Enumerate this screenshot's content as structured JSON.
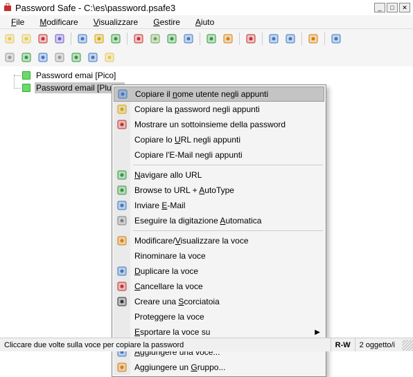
{
  "window": {
    "title": "Password Safe - C:\\es\\password.psafe3"
  },
  "menubar": {
    "file": "File",
    "edit": "Modificare",
    "view": "Visualizzare",
    "manage": "Gestire",
    "help": "Aiuto"
  },
  "tree": {
    "items": [
      {
        "label": "Password emai [Pico]",
        "selected": false
      },
      {
        "label": "Password email [Pluto]",
        "selected": true
      }
    ]
  },
  "context_menu": {
    "items": [
      {
        "label_html": "Copiare il <u>n</u>ome utente negli appunti",
        "icon": "user-icon",
        "accent": "#3a77c8",
        "hl": true
      },
      {
        "label_html": "Copiare la <u>p</u>assword negli appunti",
        "icon": "key-icon",
        "accent": "#d9a000"
      },
      {
        "label_html": "Mostrare un sottoinsieme della password",
        "icon": "subset-icon",
        "accent": "#c62e2e"
      },
      {
        "label_html": "Copiare lo <u>U</u>RL negli appunti"
      },
      {
        "label_html": "Copiare l'E-Mail negli appunti"
      },
      {
        "sep": true
      },
      {
        "label_html": "<u>N</u>avigare allo URL",
        "icon": "globe-icon",
        "accent": "#2e9a3a"
      },
      {
        "label_html": "Browse to URL + <u>A</u>utoType",
        "icon": "globe-plus-icon",
        "accent": "#2e9a3a"
      },
      {
        "label_html": "Inviare <u>E</u>-Mail",
        "icon": "mail-icon",
        "accent": "#3a77c8"
      },
      {
        "label_html": "Eseguire la digitazione <u>A</u>utomatica",
        "icon": "autotype-icon",
        "accent": "#808080"
      },
      {
        "sep": true
      },
      {
        "label_html": "Modificare/<u>V</u>isualizzare la voce",
        "icon": "pencil-icon",
        "accent": "#d97d00"
      },
      {
        "label_html": "Rinominare la voce"
      },
      {
        "label_html": "<u>D</u>uplicare la voce",
        "icon": "duplicate-icon",
        "accent": "#3a77c8"
      },
      {
        "label_html": "<u>C</u>ancellare la voce",
        "icon": "delete-icon",
        "accent": "#c62e2e"
      },
      {
        "label_html": "Creare una <u>S</u>corciatoia",
        "icon": "shortcut-icon",
        "accent": "#333333"
      },
      {
        "label_html": "Proteggere la voce"
      },
      {
        "label_html": "<u>E</u>sportare la voce su",
        "submenu": true
      },
      {
        "sep": true
      },
      {
        "label_html": "<u>A</u>ggiungere una voce...",
        "icon": "add-entry-icon",
        "accent": "#3a77c8"
      },
      {
        "label_html": "Aggiungere un <u>G</u>ruppo...",
        "icon": "add-group-icon",
        "accent": "#d97d00"
      }
    ]
  },
  "statusbar": {
    "left": "Cliccare due volte sulla voce per copiare la password",
    "rw": "R-W",
    "count": "2 oggetto/i"
  },
  "toolbar1": [
    {
      "name": "new-file-icon",
      "accent": "#e6c84a"
    },
    {
      "name": "open-file-icon",
      "accent": "#e6c84a"
    },
    {
      "name": "close-icon",
      "accent": "#c62e2e"
    },
    {
      "name": "save-icon",
      "accent": "#6a5acd"
    },
    {
      "sep": true
    },
    {
      "name": "user-copy-icon",
      "accent": "#3a77c8"
    },
    {
      "name": "key-copy-icon",
      "accent": "#d9a000"
    },
    {
      "name": "notes-copy-icon",
      "accent": "#2e9a3a"
    },
    {
      "sep": true
    },
    {
      "name": "clear-clipboard-icon",
      "accent": "#c62e2e"
    },
    {
      "name": "autotype-tb-icon",
      "accent": "#6aa84f"
    },
    {
      "name": "globe-tb-icon",
      "accent": "#2e9a3a"
    },
    {
      "name": "mail-tb-icon",
      "accent": "#3a77c8"
    },
    {
      "sep": true
    },
    {
      "name": "add-entry-tb-icon",
      "accent": "#2e9a3a"
    },
    {
      "name": "edit-entry-tb-icon",
      "accent": "#d97d00"
    },
    {
      "sep": true
    },
    {
      "name": "delete-tb-icon",
      "accent": "#c62e2e"
    },
    {
      "sep": true
    },
    {
      "name": "expand-icon",
      "accent": "#3a77c8"
    },
    {
      "name": "collapse-icon",
      "accent": "#3a77c8"
    },
    {
      "sep": true
    },
    {
      "name": "options-icon",
      "accent": "#d97d00"
    },
    {
      "sep": true
    },
    {
      "name": "help-icon",
      "accent": "#3a77c8"
    }
  ],
  "toolbar2": [
    {
      "name": "tag-icon",
      "accent": "#999999"
    },
    {
      "name": "tag-green-icon",
      "accent": "#2e9a3a"
    },
    {
      "name": "user-small-icon",
      "accent": "#3a77c8"
    },
    {
      "name": "list-icon",
      "accent": "#999999"
    },
    {
      "name": "find-icon",
      "accent": "#2e9a3a"
    },
    {
      "name": "mail-small-icon",
      "accent": "#3a77c8"
    },
    {
      "name": "folder-icon",
      "accent": "#e6c84a"
    }
  ]
}
